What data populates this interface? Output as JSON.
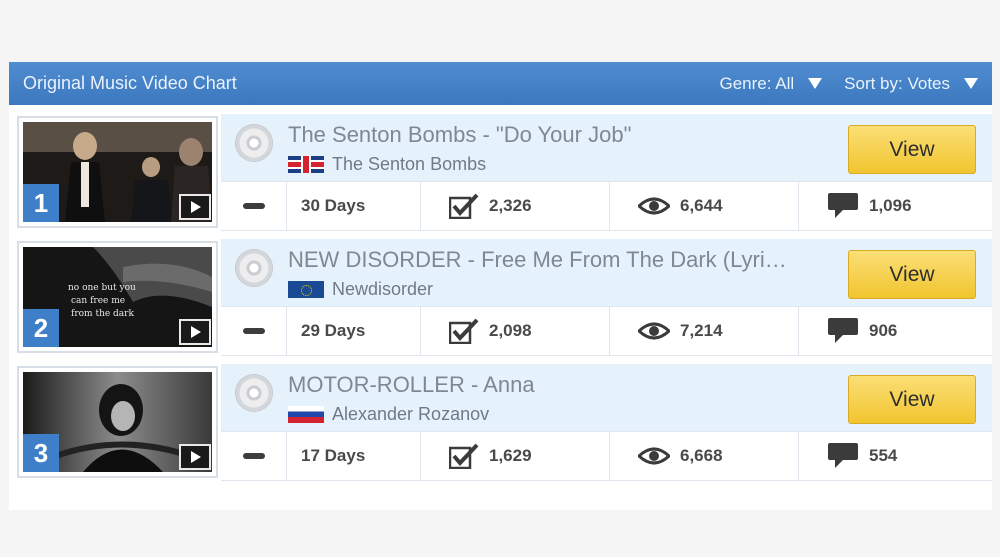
{
  "header": {
    "title": "Original Music Video Chart",
    "genre": "Genre: All",
    "sort": "Sort by: Votes"
  },
  "view_label": "View",
  "rows": [
    {
      "rank": "1",
      "song": "The Senton Bombs - \"Do Your Job\"",
      "artist": "The Senton Bombs",
      "flag": "uk-flag",
      "days": "30 Days",
      "votes": "2,326",
      "views": "6,644",
      "comments": "1,096"
    },
    {
      "rank": "2",
      "song": "NEW DISORDER - Free Me From The Dark (Lyri…",
      "artist": "Newdisorder",
      "flag": "eu-flag",
      "days": "29 Days",
      "votes": "2,098",
      "views": "7,214",
      "comments": "906"
    },
    {
      "rank": "3",
      "song": "MOTOR-ROLLER - Anna",
      "artist": "Alexander Rozanov",
      "flag": "russia-flag",
      "days": "17 Days",
      "votes": "1,629",
      "views": "6,668",
      "comments": "554"
    }
  ],
  "icons": [
    "cd-icon",
    "play-icon",
    "dash-icon",
    "checkmark-icon",
    "eye-icon",
    "comment-icon",
    "chevron-down-icon"
  ]
}
